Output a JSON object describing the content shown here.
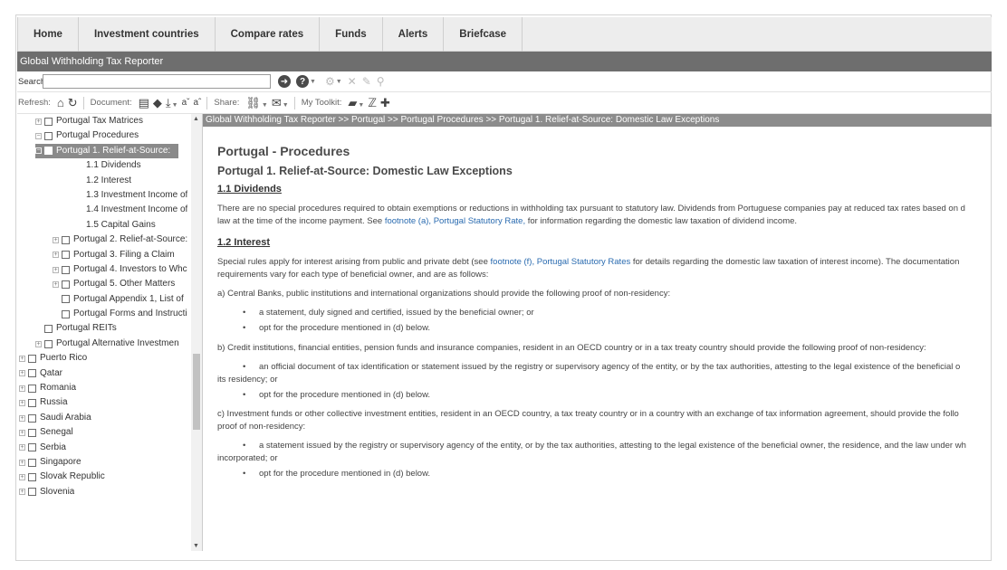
{
  "nav": {
    "tabs": [
      "Home",
      "Investment countries",
      "Compare rates",
      "Funds",
      "Alerts",
      "Briefcase"
    ]
  },
  "app_title": "Global Withholding Tax Reporter",
  "search": {
    "label": "Search:",
    "value": ""
  },
  "toolbar": {
    "refresh_label": "Refresh:",
    "document_label": "Document:",
    "share_label": "Share:",
    "toolkit_label": "My Toolkit:"
  },
  "tree": {
    "items": [
      {
        "label": "Portugal Tax Matrices"
      },
      {
        "label": "Portugal Procedures"
      },
      {
        "label": "Portugal 1. Relief-at-Source:"
      },
      {
        "label": "1.1 Dividends"
      },
      {
        "label": "1.2 Interest"
      },
      {
        "label": "1.3 Investment Income of"
      },
      {
        "label": "1.4 Investment Income of"
      },
      {
        "label": "1.5 Capital Gains"
      },
      {
        "label": "Portugal 2. Relief-at-Source:"
      },
      {
        "label": "Portugal 3. Filing a Claim"
      },
      {
        "label": "Portugal 4. Investors to Whc"
      },
      {
        "label": "Portugal 5. Other Matters"
      },
      {
        "label": "Portugal Appendix 1, List of"
      },
      {
        "label": "Portugal Forms and Instructi"
      },
      {
        "label": "Portugal REITs"
      },
      {
        "label": "Portugal Alternative Investmen"
      },
      {
        "label": "Puerto Rico"
      },
      {
        "label": "Qatar"
      },
      {
        "label": "Romania"
      },
      {
        "label": "Russia"
      },
      {
        "label": "Saudi Arabia"
      },
      {
        "label": "Senegal"
      },
      {
        "label": "Serbia"
      },
      {
        "label": "Singapore"
      },
      {
        "label": "Slovak Republic"
      },
      {
        "label": "Slovenia"
      }
    ]
  },
  "breadcrumb": "Global Withholding Tax Reporter >> Portugal >> Portugal Procedures >> Portugal 1. Relief-at-Source: Domestic Law Exceptions",
  "doc": {
    "title": "Portugal - Procedures",
    "subtitle": "Portugal 1. Relief-at-Source: Domestic Law Exceptions",
    "s1_heading": "1.1 Dividends",
    "s1_p1a": "There are no special procedures required to obtain exemptions or reductions in withholding tax pursuant to statutory law. Dividends from Portuguese companies pay at reduced tax rates based on d",
    "s1_p1b_pre": "law at the time of the income payment. See ",
    "s1_link": "footnote (a), Portugal Statutory Rate,",
    "s1_p1b_post": " for information regarding the domestic law taxation of dividend income.",
    "s2_heading": "1.2 Interest",
    "s2_p1a_pre": "Special rules apply for interest arising from public and private debt (see ",
    "s2_link": "footnote (f), Portugal Statutory Rates",
    "s2_p1a_post": " for details regarding the domestic law taxation of interest income). The documentation",
    "s2_p1b": "requirements vary for each type of beneficial owner, and are as follows:",
    "a_text": "a)  Central Banks, public institutions and international organizations should provide the following proof of non-residency:",
    "a_b1": "a statement, duly signed and certified, issued by the beneficial owner; or",
    "a_b2": "opt for the procedure mentioned in (d) below.",
    "b_text": "b)  Credit institutions, financial entities, pension funds and insurance companies, resident in an OECD country or in a tax treaty country should provide the following proof of non-residency:",
    "b_b1a": "an official document of tax identification or statement issued by the registry or supervisory agency of the entity, or by the tax authorities, attesting to the legal existence of the beneficial o",
    "b_b1b": "its residency; or",
    "b_b2": "opt for the procedure mentioned in (d) below.",
    "c_text_a": "c)     Investment funds or other collective investment entities, resident in an OECD country, a tax treaty country or in a country with an exchange of tax information agreement, should provide the follo",
    "c_text_b": "proof of non-residency:",
    "c_b1a": "a statement issued by the registry or supervisory agency of the entity, or by the tax authorities, attesting to the legal existence of the beneficial owner, the residence, and the law under wh",
    "c_b1b": "incorporated; or",
    "c_b2": "opt for the procedure mentioned in (d) below."
  }
}
